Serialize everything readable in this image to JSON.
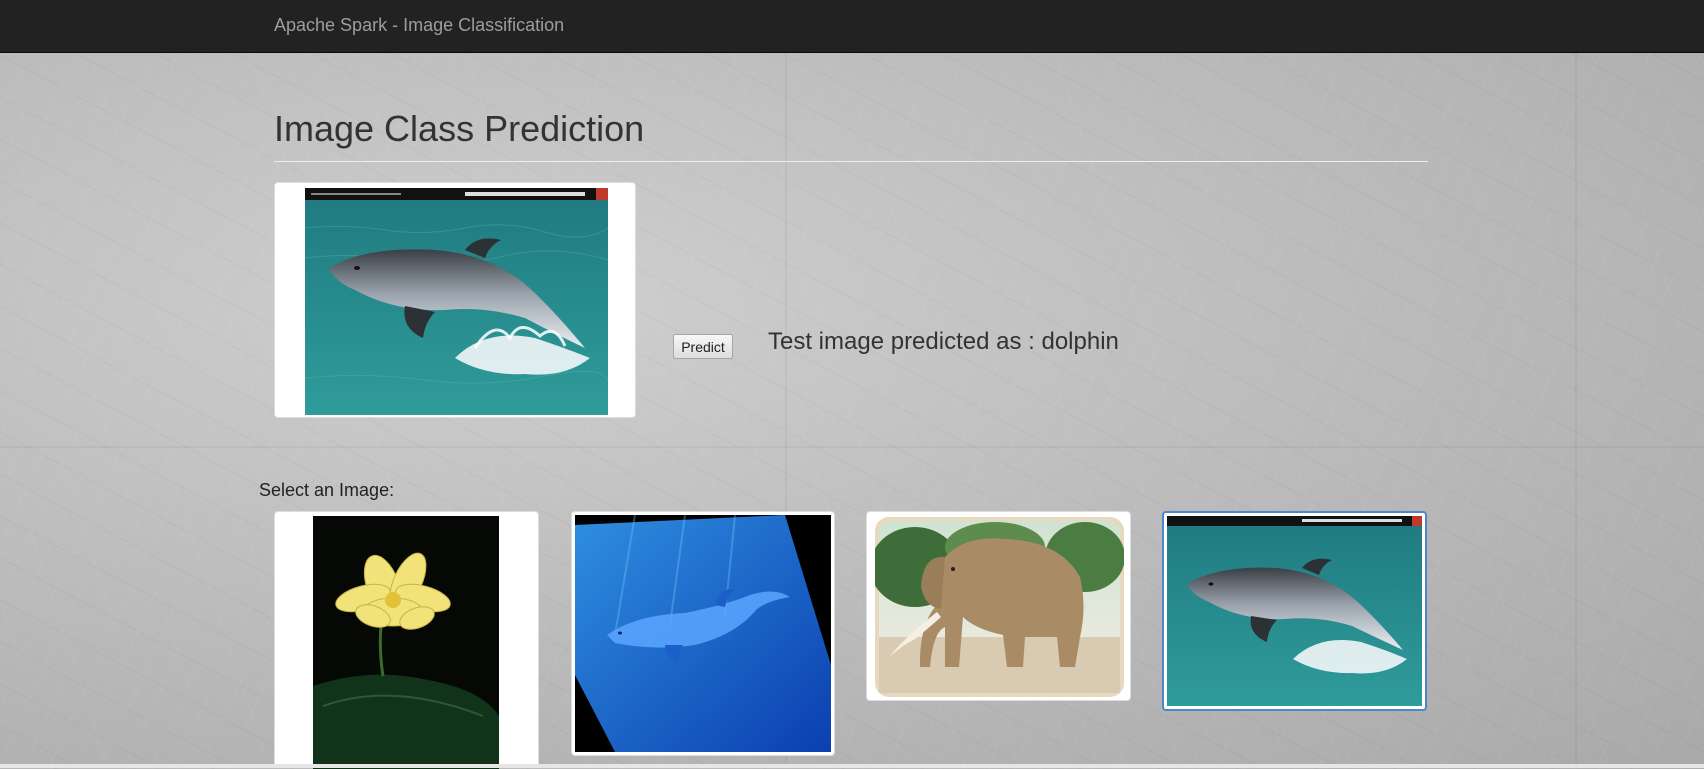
{
  "navbar": {
    "brand": "Apache Spark - Image Classification"
  },
  "main": {
    "title": "Image Class Prediction",
    "test_image": {
      "icon": "dolphin-image"
    },
    "predict_button_label": "Predict",
    "result_text": "Test image predicted as : dolphin"
  },
  "gallery": {
    "label": "Select an Image:",
    "images": [
      {
        "icon": "lotus-flower-image",
        "selected": false
      },
      {
        "icon": "dolphin-underwater-image",
        "selected": false
      },
      {
        "icon": "elephant-image",
        "selected": false
      },
      {
        "icon": "dolphin-jumping-image",
        "selected": true
      }
    ]
  },
  "colors": {
    "navbar_bg": "#222222",
    "brand_text": "#9d9d9d",
    "selected_border": "#4d86c9"
  }
}
